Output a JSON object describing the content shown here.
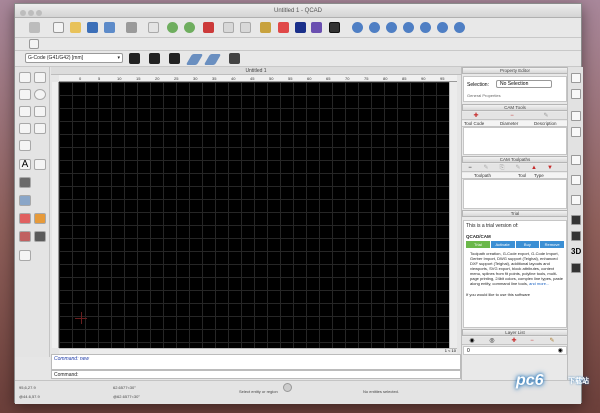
{
  "window": {
    "title": "Untitled 1 - QCAD"
  },
  "toolbar": {
    "gcode_select": "G-Code (G41/G42) [mm]"
  },
  "drawing": {
    "tab_title": "Untitled 1",
    "ruler_ticks": [
      "0",
      "5",
      "10",
      "15",
      "20",
      "25",
      "30",
      "35",
      "40",
      "45",
      "50",
      "55",
      "60",
      "65",
      "70",
      "75",
      "80",
      "85",
      "90",
      "95"
    ],
    "scale_label": "1 < 10"
  },
  "command": {
    "history": "Command: new",
    "prompt": "Command:"
  },
  "status": {
    "coord_abs": "95,6,27.9",
    "coord_rel": "@44.6,57.9",
    "polar_abs": "62.6577<30°",
    "polar_rel": "@62.6577<30°",
    "hint": "Select entity or region",
    "selection": "No entities selected."
  },
  "property_editor": {
    "title": "Property Editor",
    "selection_label": "Selection:",
    "selection_value": "No Selection",
    "general": "General Properties"
  },
  "cam_tools": {
    "title": "CAM Tools",
    "columns": [
      "Tool Code",
      "Diameter",
      "Description"
    ]
  },
  "cam_toolpaths": {
    "title": "CAM Toolpaths",
    "columns": [
      "Toolpath",
      "Tool",
      "Type"
    ]
  },
  "trial": {
    "title": "Trial",
    "intro": "This is a trial version of:",
    "product": "QCAD/CAM",
    "tabs": [
      "Trial",
      "Activate",
      "Buy",
      "Remove"
    ],
    "body": "Toolpath creation, G-Code export, G-Code Import, Gerber Import, DWG support (Teighal), enhanced DXF support (Teighal), additional layouts and viewports, SVG export, block attributes, context menu, splines from fit points, polyline tools, multi-page printing, 24bit colors, complex line types, paste along entity, command line tools,",
    "more": "and more...",
    "footer": "If you would like to use this software"
  },
  "layer_list": {
    "title": "Layer List",
    "layer": "0"
  },
  "watermark": {
    "text": "pc6",
    "sub": "下载站"
  }
}
